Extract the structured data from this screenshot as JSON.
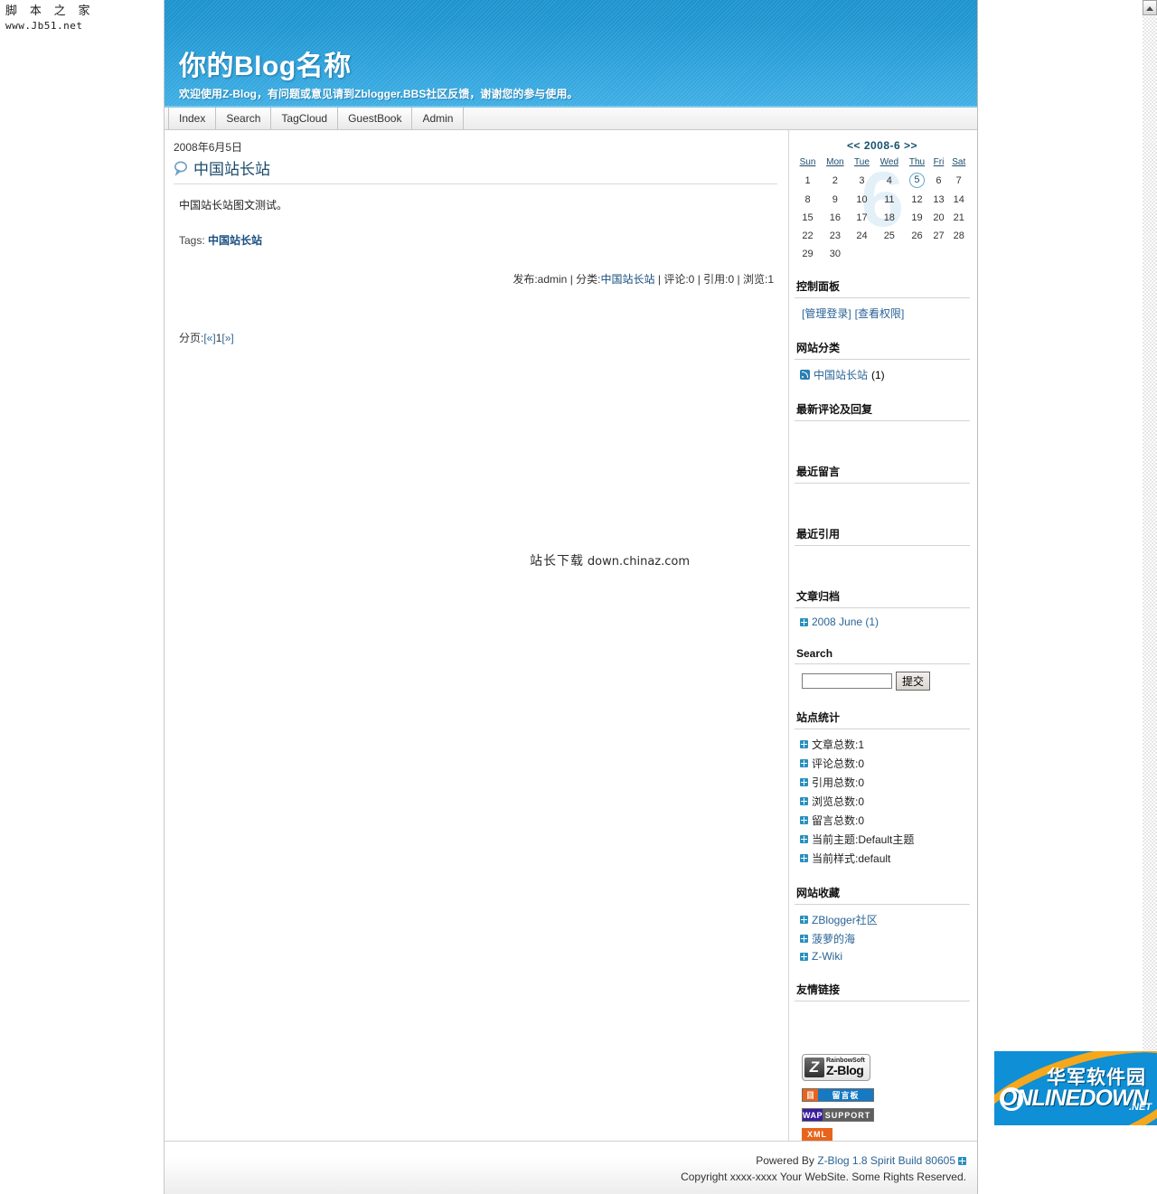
{
  "watermarks": {
    "topleft_cn": "脚 本 之 家",
    "topleft_url": "www.Jb51.net",
    "center_cn": "站长下载",
    "center_url": "down.chinaz.com",
    "onlinedown_cn": "华军软件园",
    "onlinedown_en": "ONLINEDOWN",
    "onlinedown_tld": ".NET"
  },
  "header": {
    "title": "你的Blog名称",
    "subtitle": "欢迎使用Z-Blog，有问题或意见请到Zblogger.BBS社区反馈，谢谢您的参与使用。"
  },
  "nav": {
    "tabs": [
      {
        "label": "Index"
      },
      {
        "label": "Search"
      },
      {
        "label": "TagCloud"
      },
      {
        "label": "GuestBook"
      },
      {
        "label": "Admin"
      }
    ]
  },
  "post": {
    "date": "2008年6月5日",
    "title": "中国站长站",
    "title_icon": "comment-bubble-icon",
    "body": "中国站长站图文测试。",
    "tags_label": "Tags:",
    "tags_value": "中国站长站",
    "meta": {
      "author_label": "发布:",
      "author": "admin",
      "category_label": "分类:",
      "category": "中国站长站",
      "comments": "评论:0",
      "trackbacks": "引用:0",
      "views": "浏览:1",
      "separator": "|"
    },
    "pager": {
      "label": "分页:",
      "prev": "[«]",
      "current": "1",
      "next": "[»]"
    }
  },
  "sidebar": {
    "calendar": {
      "prev": "<<",
      "title": "2008-6",
      "next": ">>",
      "watermark": "6",
      "weekdays": [
        "Sun",
        "Mon",
        "Tue",
        "Wed",
        "Thu",
        "Fri",
        "Sat"
      ],
      "weeks": [
        [
          "1",
          "2",
          "3",
          "4",
          "5",
          "6",
          "7"
        ],
        [
          "8",
          "9",
          "10",
          "11",
          "12",
          "13",
          "14"
        ],
        [
          "15",
          "16",
          "17",
          "18",
          "19",
          "20",
          "21"
        ],
        [
          "22",
          "23",
          "24",
          "25",
          "26",
          "27",
          "28"
        ],
        [
          "29",
          "30",
          "",
          "",
          "",
          "",
          ""
        ]
      ],
      "today": "5"
    },
    "control_panel": {
      "heading": "控制面板",
      "login_link": "[管理登录]",
      "permission_link": "[查看权限]"
    },
    "categories": {
      "heading": "网站分类",
      "items": [
        {
          "icon": "feed-icon",
          "label": "中国站长站",
          "count": "(1)"
        }
      ]
    },
    "recent_comments": {
      "heading": "最新评论及回复",
      "items": []
    },
    "recent_guestbook": {
      "heading": "最近留言",
      "items": []
    },
    "recent_trackbacks": {
      "heading": "最近引用",
      "items": []
    },
    "archives": {
      "heading": "文章归档",
      "items": [
        {
          "label": "2008 June (1)"
        }
      ]
    },
    "search": {
      "heading": "Search",
      "value": "",
      "placeholder": "",
      "submit_label": "提交"
    },
    "statistics": {
      "heading": "站点统计",
      "items": [
        "文章总数:1",
        "评论总数:0",
        "引用总数:0",
        "浏览总数:0",
        "留言总数:0",
        "当前主题:Default主题",
        "当前样式:default"
      ]
    },
    "favorites": {
      "heading": "网站收藏",
      "items": [
        {
          "label": "ZBlogger社区"
        },
        {
          "label": "菠萝的海"
        },
        {
          "label": "Z-Wiki"
        }
      ]
    },
    "friendlinks": {
      "heading": "友情链接",
      "items": []
    },
    "badges": {
      "zblog_brand": "RainbowSoft",
      "zblog_name": "Z-Blog",
      "zblog_letter": "Z",
      "guestbook_icon": "目",
      "guestbook_label": "留言板",
      "wap_left": "WAP",
      "wap_right": "SUPPORT",
      "xml_label": "XML"
    }
  },
  "footer": {
    "powered_prefix": "Powered By ",
    "powered_link": "Z-Blog 1.8 Spirit Build 80605",
    "copyright": "Copyright xxxx-xxxx Your WebSite. Some Rights Reserved."
  },
  "colors": {
    "banner_blue": "#2ba0da",
    "link_blue": "#2a6496",
    "heading_dark": "#16526f",
    "accent_orange": "#e8641e"
  }
}
